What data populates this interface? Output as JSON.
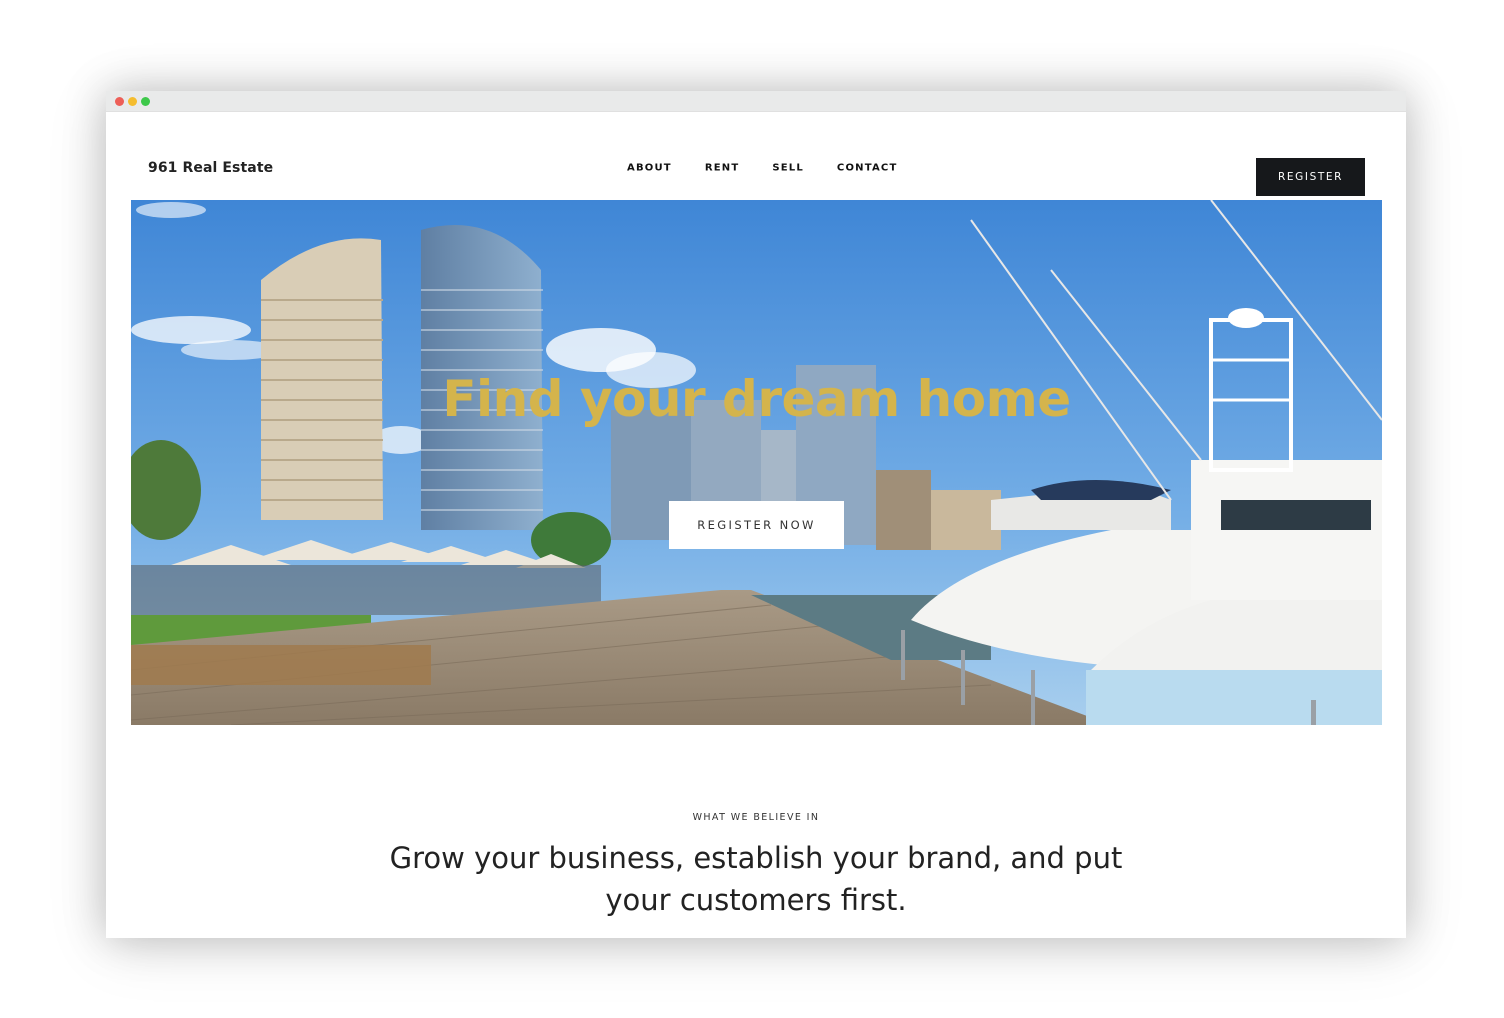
{
  "site": {
    "brand": "961 Real Estate",
    "register_label": "REGISTER"
  },
  "nav": {
    "items": [
      {
        "label": "ABOUT"
      },
      {
        "label": "RENT"
      },
      {
        "label": "SELL"
      },
      {
        "label": "CONTACT"
      }
    ]
  },
  "hero": {
    "title": "Find your dream home",
    "cta_label": "REGISTER NOW",
    "title_color": "#d4b44c"
  },
  "about": {
    "eyebrow": "WHAT WE BELIEVE IN",
    "statement": "Grow your business, establish your brand, and put your customers first."
  },
  "colors": {
    "button_dark": "#16181b",
    "sky": "#4c8fd8"
  }
}
